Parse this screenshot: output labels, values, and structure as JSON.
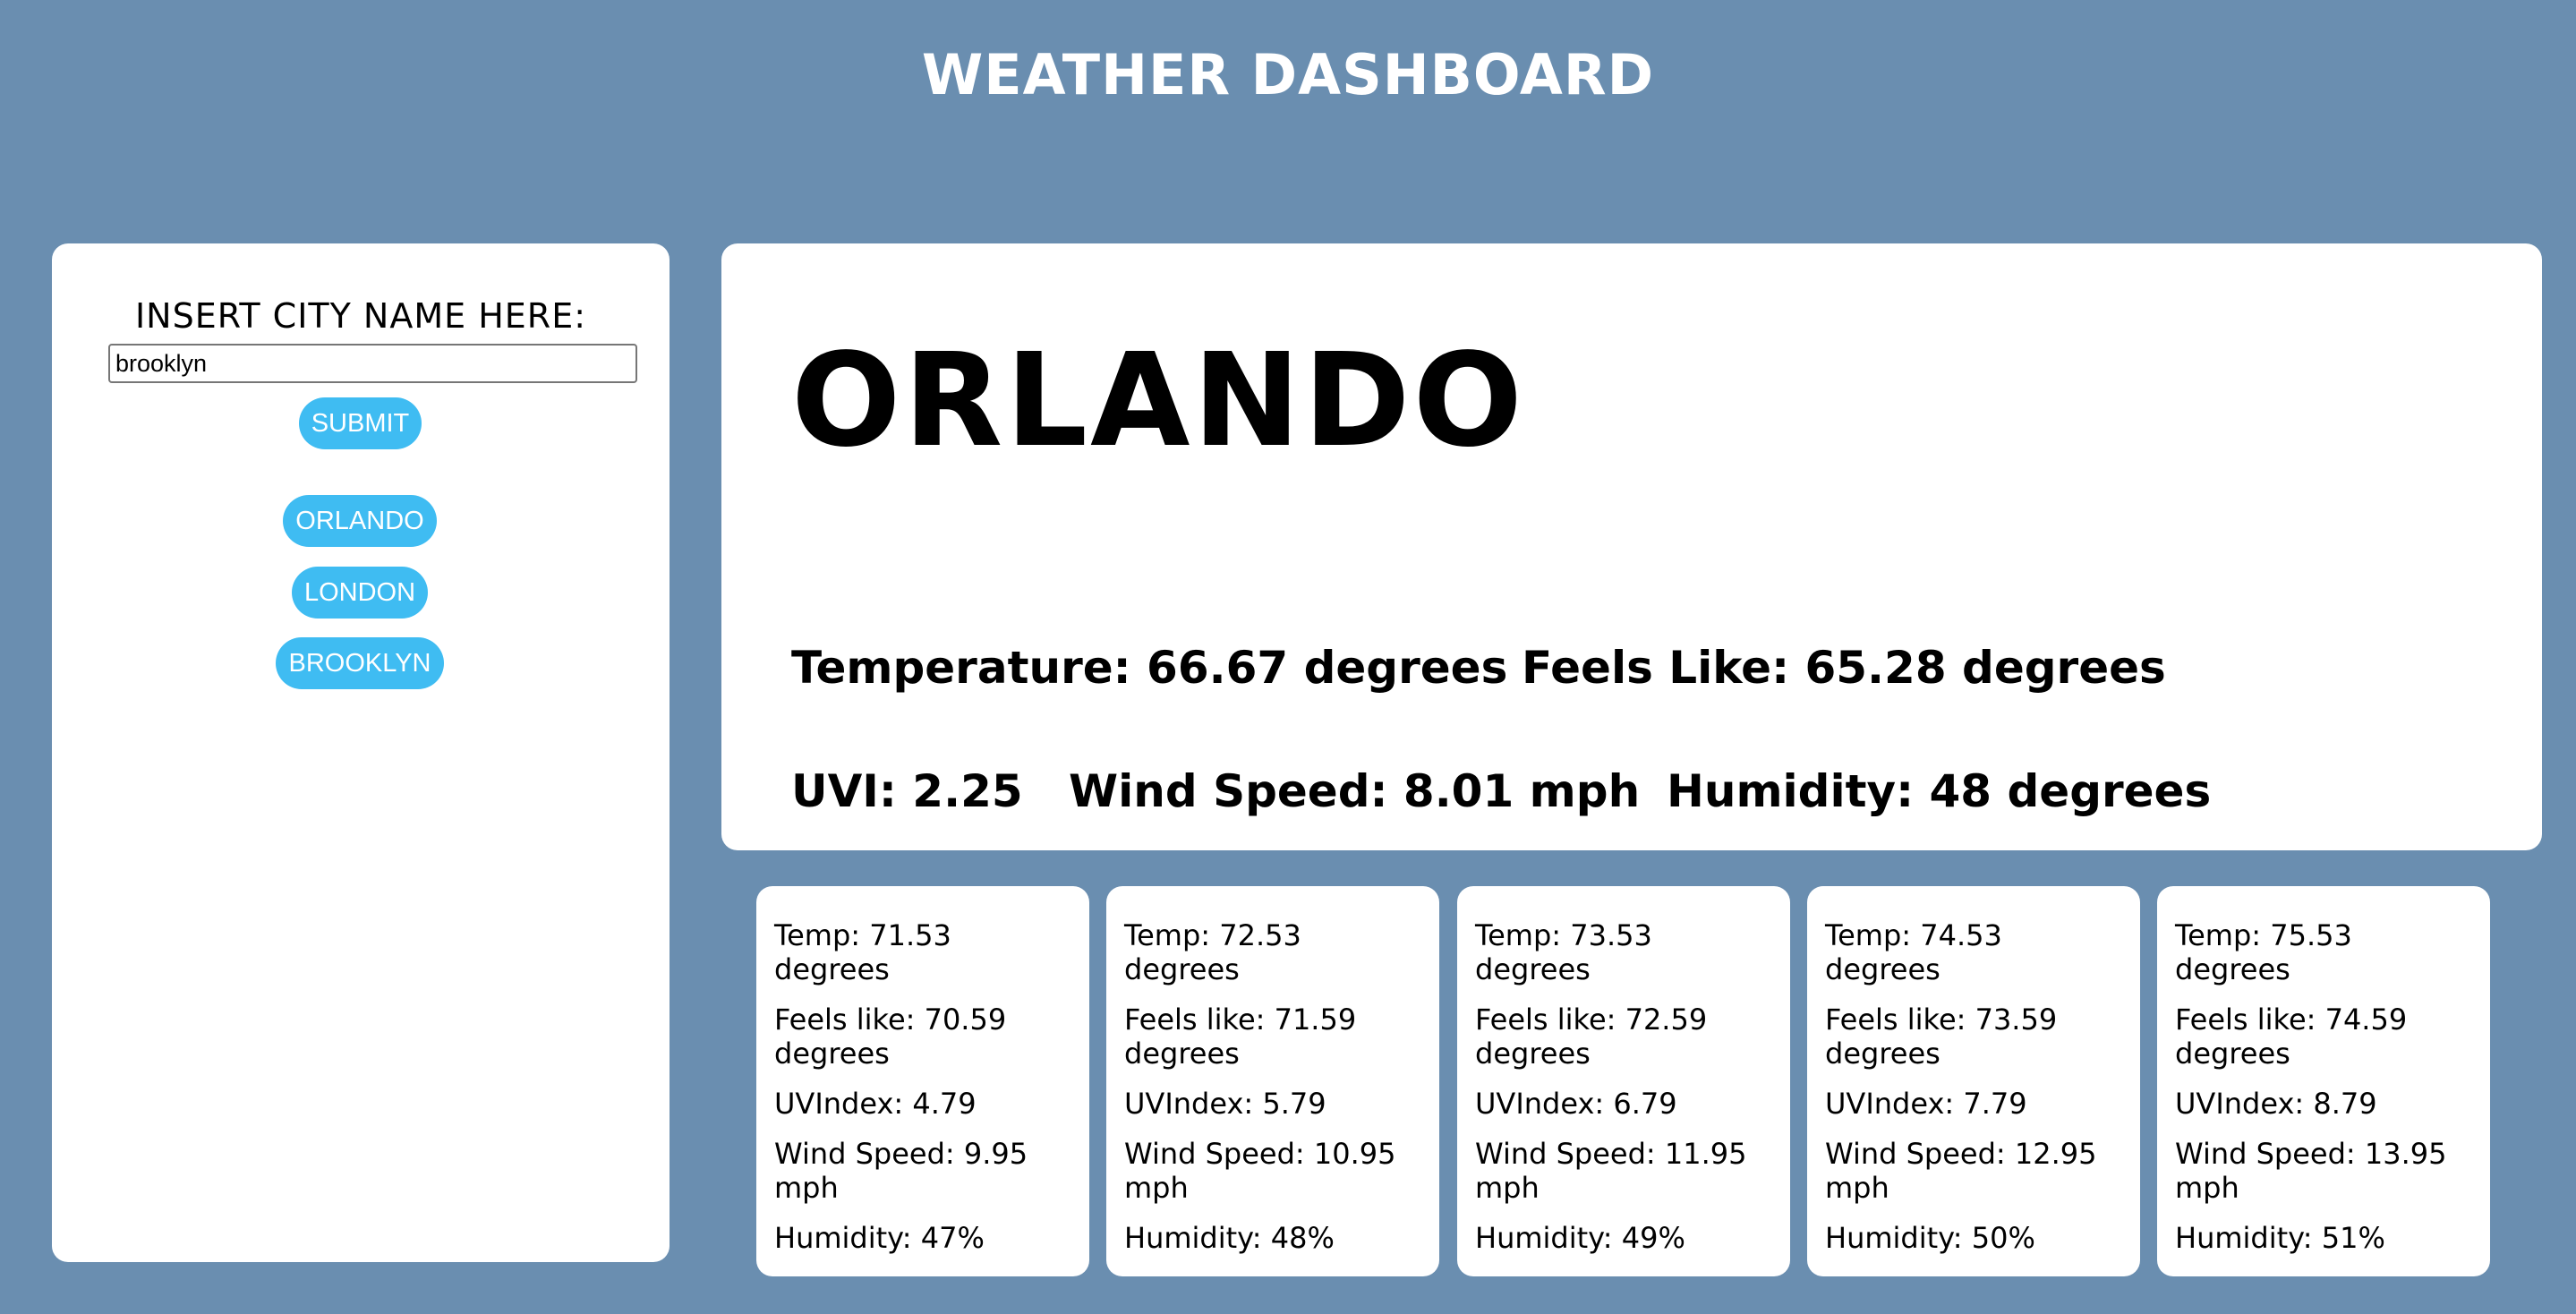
{
  "page": {
    "title": "WEATHER DASHBOARD"
  },
  "sidebar": {
    "label": "INSERT CITY NAME HERE:",
    "input_value": "brooklyn",
    "submit_label": "SUBMIT",
    "history": [
      "ORLANDO",
      "LONDON",
      "BROOKLYN"
    ],
    "accent_color": "#3fbcf2"
  },
  "current": {
    "city": "ORLANDO",
    "temperature": "Temperature: 66.67 degrees",
    "feels_like": "Feels Like: 65.28 degrees",
    "uvi": "UVI: 2.25",
    "wind_speed": "Wind Speed: 8.01 mph",
    "humidity": "Humidity: 48 degrees"
  },
  "forecast": [
    {
      "temp": "Temp: 71.53 degrees",
      "feels": "Feels like: 70.59 degrees",
      "uv": "UVIndex: 4.79",
      "wind": "Wind Speed: 9.95 mph",
      "humidity": "Humidity: 47%"
    },
    {
      "temp": "Temp: 72.53 degrees",
      "feels": "Feels like: 71.59 degrees",
      "uv": "UVIndex: 5.79",
      "wind": "Wind Speed: 10.95 mph",
      "humidity": "Humidity: 48%"
    },
    {
      "temp": "Temp: 73.53 degrees",
      "feels": "Feels like: 72.59 degrees",
      "uv": "UVIndex: 6.79",
      "wind": "Wind Speed: 11.95 mph",
      "humidity": "Humidity: 49%"
    },
    {
      "temp": "Temp: 74.53 degrees",
      "feels": "Feels like: 73.59 degrees",
      "uv": "UVIndex: 7.79",
      "wind": "Wind Speed: 12.95 mph",
      "humidity": "Humidity: 50%"
    },
    {
      "temp": "Temp: 75.53 degrees",
      "feels": "Feels like: 74.59 degrees",
      "uv": "UVIndex: 8.79",
      "wind": "Wind Speed: 13.95 mph",
      "humidity": "Humidity: 51%"
    }
  ],
  "colors": {
    "background": "#6a8eb0",
    "panel": "#ffffff",
    "button": "#3fbcf2"
  }
}
